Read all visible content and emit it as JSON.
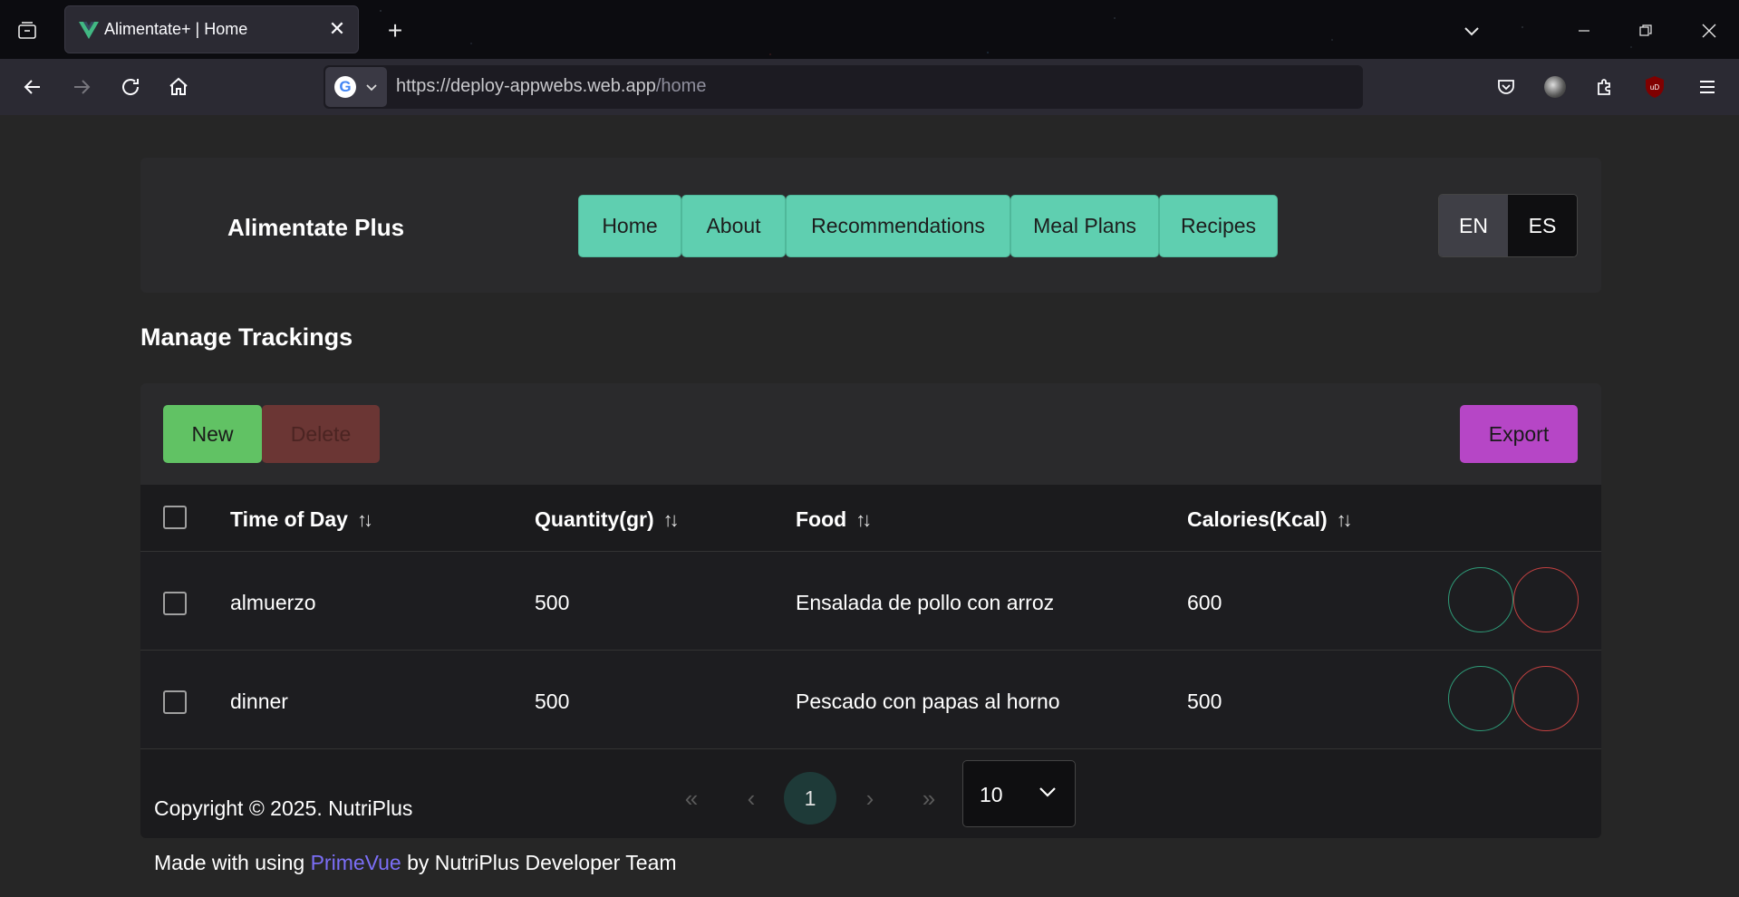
{
  "browser": {
    "tab_title": "Alimentate+ | Home",
    "url_host": "https://deploy-appwebs.web.app",
    "url_path": "/home"
  },
  "header": {
    "brand": "Alimentate Plus",
    "menu": [
      {
        "label": "Home"
      },
      {
        "label": "About"
      },
      {
        "label": "Recommendations"
      },
      {
        "label": "Meal Plans"
      },
      {
        "label": "Recipes"
      }
    ],
    "languages": {
      "en": "EN",
      "es": "ES",
      "selected": "EN"
    }
  },
  "main": {
    "title": "Manage Trackings",
    "toolbar": {
      "new_label": "New",
      "delete_label": "Delete",
      "export_label": "Export"
    },
    "table": {
      "columns": [
        "Time of Day",
        "Quantity(gr)",
        "Food",
        "Calories(Kcal)"
      ],
      "rows": [
        {
          "time": "almuerzo",
          "quantity": "500",
          "food": "Ensalada de pollo con arroz",
          "calories": "600"
        },
        {
          "time": "dinner",
          "quantity": "500",
          "food": "Pescado con papas al horno",
          "calories": "500"
        }
      ]
    },
    "paginator": {
      "current_page": "1",
      "rows_per_page": "10"
    }
  },
  "footer": {
    "copyright": "Copyright © 2025. NutriPlus",
    "made_with_prefix": "Made with using ",
    "made_with_link": "PrimeVue",
    "made_with_suffix": " by NutriPlus Developer Team"
  }
}
